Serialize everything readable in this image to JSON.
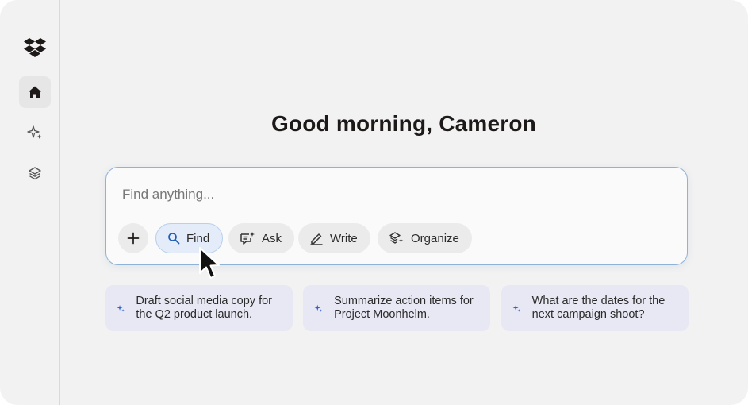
{
  "greeting": "Good morning, Cameron",
  "search": {
    "placeholder": "Find anything..."
  },
  "modes": [
    {
      "label": "Find",
      "icon": "search-icon"
    },
    {
      "label": "Ask",
      "icon": "chat-sparkle-icon"
    },
    {
      "label": "Write",
      "icon": "pen-icon"
    },
    {
      "label": "Organize",
      "icon": "layers-sparkle-icon"
    }
  ],
  "selected_mode": "Find",
  "suggestions": [
    {
      "text": "Draft social media copy for the Q2 product launch.",
      "icon": "sparkle-icon"
    },
    {
      "text": "Summarize action items for Project Moonhelm.",
      "icon": "sparkle-icon"
    },
    {
      "text": "What are the dates for the next campaign shoot?",
      "icon": "sparkle-icon"
    }
  ],
  "sidebar": {
    "items": [
      {
        "icon": "dropbox-logo-icon"
      },
      {
        "icon": "home-icon",
        "active": true
      },
      {
        "icon": "sparkle-icon"
      },
      {
        "icon": "layers-icon"
      }
    ]
  },
  "colors": {
    "background": "#f2f2f2",
    "input_border": "#8fb2d9",
    "selected_chip": "#e3ecf8",
    "suggestion_bg": "#e7e8f3",
    "sparkle_blue": "#2f5fd0"
  }
}
